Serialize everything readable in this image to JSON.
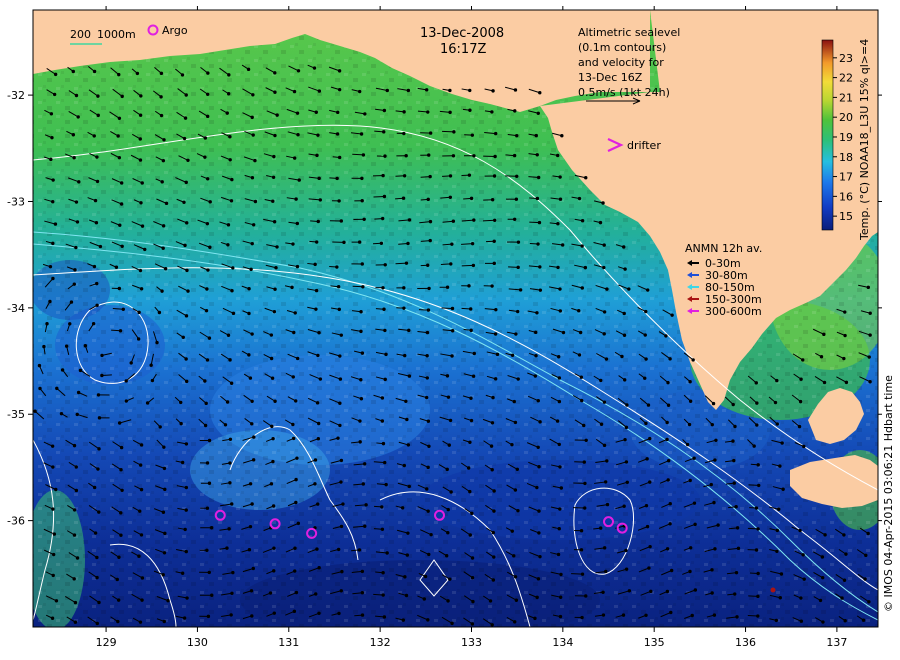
{
  "map": {
    "date": "13-Dec-2008",
    "time": "16:17Z",
    "bathymetry_legend": {
      "shallow": "200",
      "deep": "1000m"
    },
    "argo_label": "Argo",
    "altimetry_lines": [
      "Altimetric sealevel",
      "(0.1m contours)",
      "and velocity for",
      "13-Dec 16Z",
      "0.5m/s (1kt 24h)"
    ],
    "drifter_label": "drifter",
    "anmn": {
      "title": "ANMN 12h av.",
      "items": [
        {
          "label": "0-30m",
          "color": "#000000"
        },
        {
          "label": "30-80m",
          "color": "#1f4fd8"
        },
        {
          "label": "80-150m",
          "color": "#3ed6e6"
        },
        {
          "label": "150-300m",
          "color": "#a81414"
        },
        {
          "label": "300-600m",
          "color": "#e020e0"
        }
      ]
    },
    "colorbar": {
      "title": "Temp. (°C) NOAA18_L3U 15% ql>=4",
      "ticks": [
        "23",
        "22",
        "21",
        "20",
        "19",
        "18",
        "17",
        "16",
        "15"
      ],
      "range": [
        14.3,
        23.9
      ]
    },
    "credit": "© IMOS 04-Apr-2015 03:06:21 Hdbart time",
    "x_axis": {
      "ticks": [
        "129",
        "130",
        "131",
        "132",
        "133",
        "134",
        "135",
        "136",
        "137"
      ],
      "range": [
        128.2,
        137.45
      ]
    },
    "y_axis": {
      "ticks": [
        "-32",
        "-33",
        "-34",
        "-35",
        "-36"
      ],
      "range": [
        -37.0,
        -31.2
      ]
    },
    "argo_floats": [
      {
        "lon": 130.25,
        "lat": -35.95
      },
      {
        "lon": 130.85,
        "lat": -36.03
      },
      {
        "lon": 131.25,
        "lat": -36.12
      },
      {
        "lon": 132.65,
        "lat": -35.95
      },
      {
        "lon": 134.5,
        "lat": -36.01
      },
      {
        "lon": 134.65,
        "lat": -36.07
      }
    ],
    "colors": {
      "land": "#fbcca3",
      "argo": "#e020e0",
      "drifter": "#e020e0",
      "contour": "#ffffff",
      "isobath": "#7fe6f2",
      "bathy_legend_line": "#3ed6a0"
    }
  }
}
